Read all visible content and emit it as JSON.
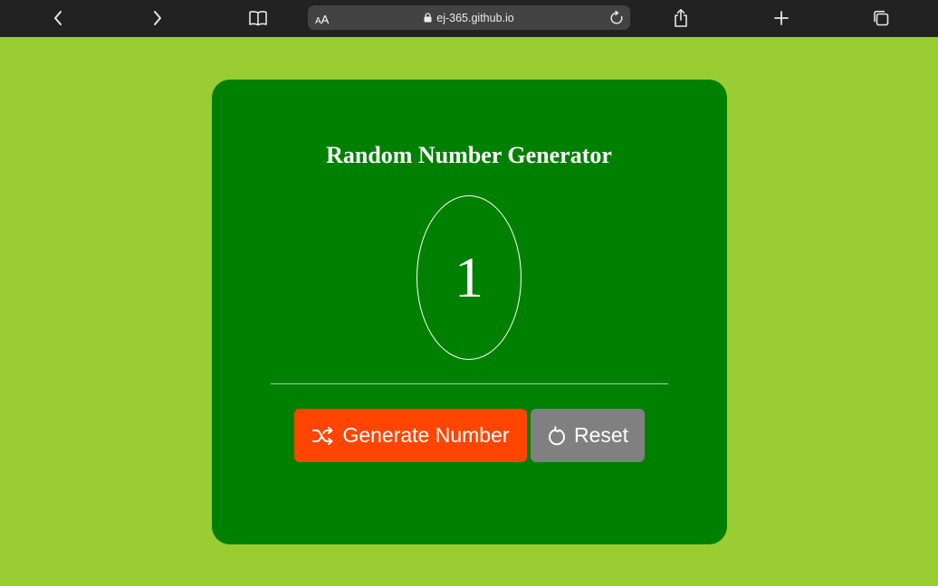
{
  "browser": {
    "aa_label_small": "A",
    "aa_label_large": "A",
    "url": "ej-365.github.io",
    "icons": [
      "back-icon",
      "forward-icon",
      "bookmarks-icon",
      "lock-icon",
      "reload-icon",
      "share-icon",
      "new-tab-icon",
      "tabs-icon"
    ],
    "toolbar_color": "#222222",
    "address_bar_color": "#434343"
  },
  "app": {
    "title": "Random Number Generator",
    "number": "1",
    "generate_label": "Generate Number",
    "reset_label": "Reset",
    "generate_icon": "shuffle-icon",
    "reset_icon": "reset-icon"
  },
  "colors": {
    "page_background": "#9acd32",
    "card_background": "#008000",
    "generate_button": "#ff4500",
    "reset_button": "#808080",
    "text": "#ffffff"
  }
}
